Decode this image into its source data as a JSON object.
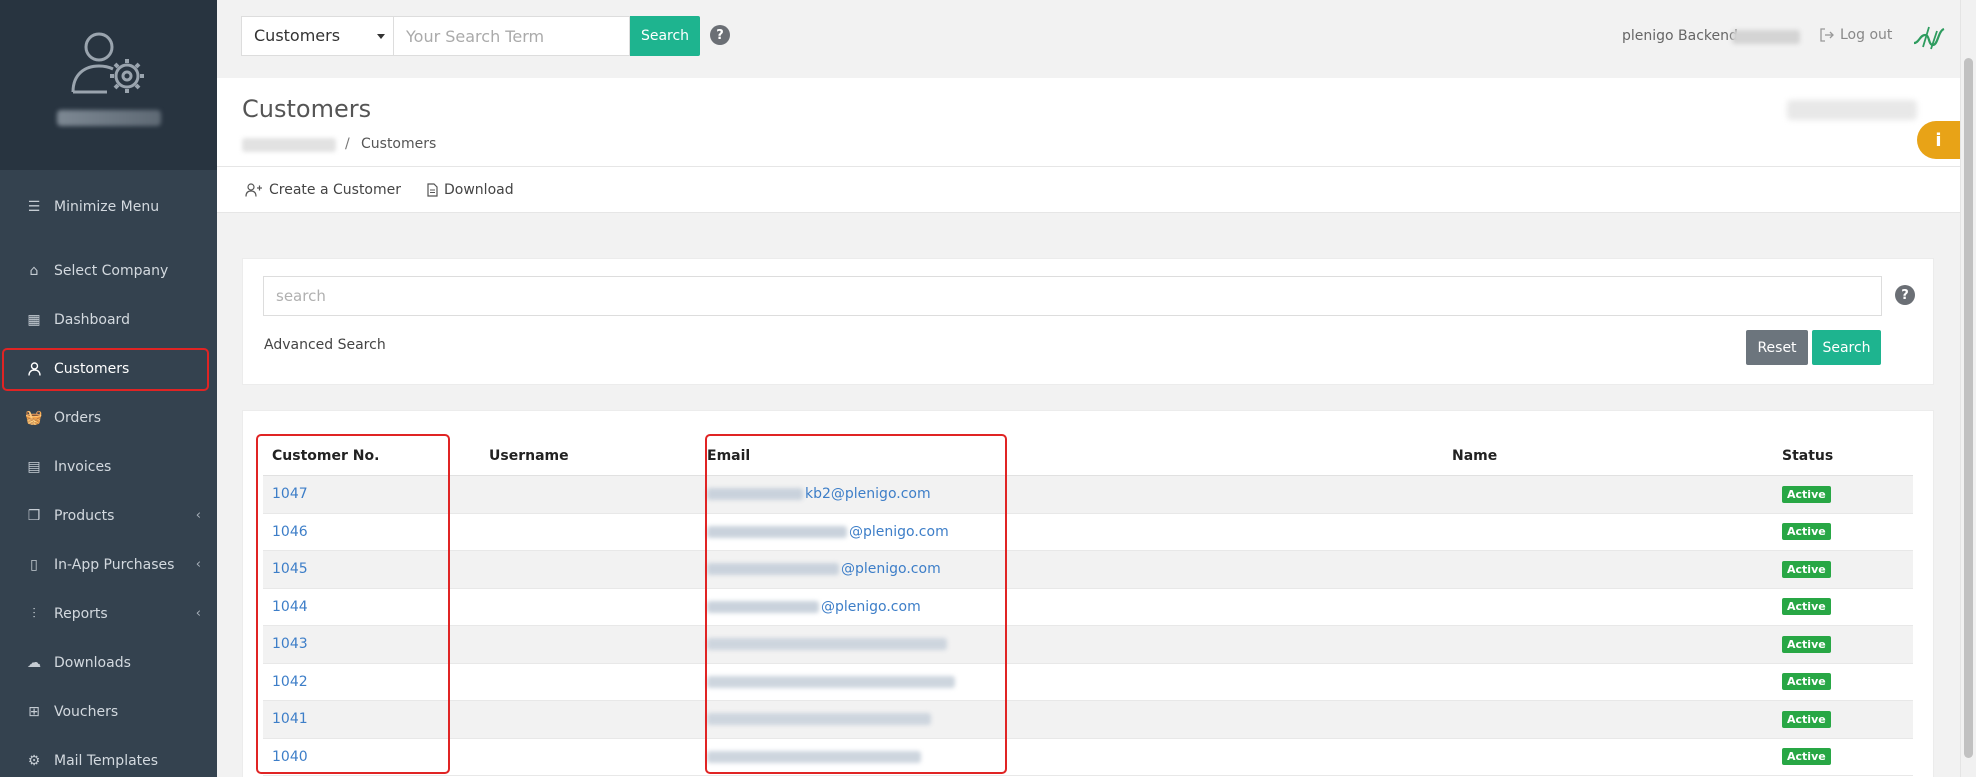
{
  "sidebar": {
    "items": [
      {
        "label": "Minimize Menu",
        "icon": "hamburger-icon"
      },
      {
        "label": "Select Company",
        "icon": "home-icon"
      },
      {
        "label": "Dashboard",
        "icon": "grid-icon"
      },
      {
        "label": "Customers",
        "icon": "user-icon",
        "active": true
      },
      {
        "label": "Orders",
        "icon": "basket-icon"
      },
      {
        "label": "Invoices",
        "icon": "document-icon"
      },
      {
        "label": "Products",
        "icon": "box-icon",
        "submenu": true
      },
      {
        "label": "In-App Purchases",
        "icon": "phone-icon",
        "submenu": true
      },
      {
        "label": "Reports",
        "icon": "chart-icon",
        "submenu": true
      },
      {
        "label": "Downloads",
        "icon": "cloud-download-icon"
      },
      {
        "label": "Vouchers",
        "icon": "gift-icon"
      },
      {
        "label": "Mail Templates",
        "icon": "gears-icon"
      }
    ]
  },
  "topbar": {
    "entity_select": "Customers",
    "search_placeholder": "Your Search Term",
    "search_button": "Search",
    "help": "?",
    "backend_label": "plenigo Backend",
    "logout_label": "Log out"
  },
  "header": {
    "title": "Customers",
    "breadcrumb_sep": "/",
    "breadcrumb_current": "Customers",
    "info": "i"
  },
  "actions": {
    "create": "Create a Customer",
    "download": "Download"
  },
  "search_panel": {
    "placeholder": "search",
    "advanced": "Advanced Search",
    "reset": "Reset",
    "search": "Search",
    "help": "?"
  },
  "table": {
    "headers": {
      "no": "Customer No.",
      "username": "Username",
      "email": "Email",
      "name": "Name",
      "status": "Status"
    },
    "rows": [
      {
        "no": "1047",
        "username": "",
        "email_suffix": "kb2@plenigo.com",
        "name": "",
        "status": "Active"
      },
      {
        "no": "1046",
        "username": "",
        "email_suffix": "@plenigo.com",
        "name": "",
        "status": "Active"
      },
      {
        "no": "1045",
        "username": "",
        "email_suffix": "@plenigo.com",
        "name": "",
        "status": "Active"
      },
      {
        "no": "1044",
        "username": "",
        "email_suffix": "@plenigo.com",
        "name": "",
        "status": "Active"
      },
      {
        "no": "1043",
        "username": "",
        "email_suffix": "",
        "name": "",
        "status": "Active"
      },
      {
        "no": "1042",
        "username": "",
        "email_suffix": "",
        "name": "",
        "status": "Active"
      },
      {
        "no": "1041",
        "username": "",
        "email_suffix": "",
        "name": "",
        "status": "Active"
      },
      {
        "no": "1040",
        "username": "",
        "email_suffix": "",
        "name": "",
        "status": "Active"
      }
    ]
  },
  "colors": {
    "sidebar": "#34424f",
    "sidebar_header": "#283440",
    "accent": "#1eb48f",
    "highlight": "#e02424",
    "info_tab": "#e8a317",
    "link": "#3d7ec8",
    "badge": "#28a745"
  }
}
